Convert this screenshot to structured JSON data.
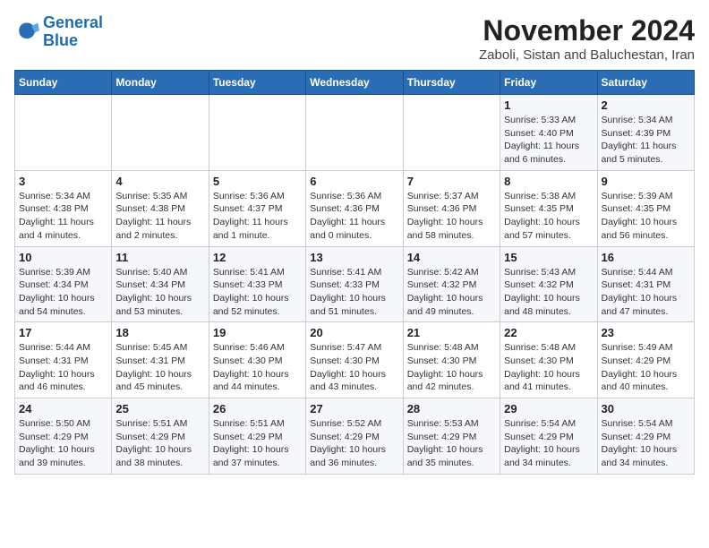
{
  "logo": {
    "line1": "General",
    "line2": "Blue"
  },
  "title": "November 2024",
  "location": "Zaboli, Sistan and Baluchestan, Iran",
  "days_of_week": [
    "Sunday",
    "Monday",
    "Tuesday",
    "Wednesday",
    "Thursday",
    "Friday",
    "Saturday"
  ],
  "weeks": [
    [
      {
        "day": "",
        "detail": ""
      },
      {
        "day": "",
        "detail": ""
      },
      {
        "day": "",
        "detail": ""
      },
      {
        "day": "",
        "detail": ""
      },
      {
        "day": "",
        "detail": ""
      },
      {
        "day": "1",
        "detail": "Sunrise: 5:33 AM\nSunset: 4:40 PM\nDaylight: 11 hours and 6 minutes."
      },
      {
        "day": "2",
        "detail": "Sunrise: 5:34 AM\nSunset: 4:39 PM\nDaylight: 11 hours and 5 minutes."
      }
    ],
    [
      {
        "day": "3",
        "detail": "Sunrise: 5:34 AM\nSunset: 4:38 PM\nDaylight: 11 hours and 4 minutes."
      },
      {
        "day": "4",
        "detail": "Sunrise: 5:35 AM\nSunset: 4:38 PM\nDaylight: 11 hours and 2 minutes."
      },
      {
        "day": "5",
        "detail": "Sunrise: 5:36 AM\nSunset: 4:37 PM\nDaylight: 11 hours and 1 minute."
      },
      {
        "day": "6",
        "detail": "Sunrise: 5:36 AM\nSunset: 4:36 PM\nDaylight: 11 hours and 0 minutes."
      },
      {
        "day": "7",
        "detail": "Sunrise: 5:37 AM\nSunset: 4:36 PM\nDaylight: 10 hours and 58 minutes."
      },
      {
        "day": "8",
        "detail": "Sunrise: 5:38 AM\nSunset: 4:35 PM\nDaylight: 10 hours and 57 minutes."
      },
      {
        "day": "9",
        "detail": "Sunrise: 5:39 AM\nSunset: 4:35 PM\nDaylight: 10 hours and 56 minutes."
      }
    ],
    [
      {
        "day": "10",
        "detail": "Sunrise: 5:39 AM\nSunset: 4:34 PM\nDaylight: 10 hours and 54 minutes."
      },
      {
        "day": "11",
        "detail": "Sunrise: 5:40 AM\nSunset: 4:34 PM\nDaylight: 10 hours and 53 minutes."
      },
      {
        "day": "12",
        "detail": "Sunrise: 5:41 AM\nSunset: 4:33 PM\nDaylight: 10 hours and 52 minutes."
      },
      {
        "day": "13",
        "detail": "Sunrise: 5:41 AM\nSunset: 4:33 PM\nDaylight: 10 hours and 51 minutes."
      },
      {
        "day": "14",
        "detail": "Sunrise: 5:42 AM\nSunset: 4:32 PM\nDaylight: 10 hours and 49 minutes."
      },
      {
        "day": "15",
        "detail": "Sunrise: 5:43 AM\nSunset: 4:32 PM\nDaylight: 10 hours and 48 minutes."
      },
      {
        "day": "16",
        "detail": "Sunrise: 5:44 AM\nSunset: 4:31 PM\nDaylight: 10 hours and 47 minutes."
      }
    ],
    [
      {
        "day": "17",
        "detail": "Sunrise: 5:44 AM\nSunset: 4:31 PM\nDaylight: 10 hours and 46 minutes."
      },
      {
        "day": "18",
        "detail": "Sunrise: 5:45 AM\nSunset: 4:31 PM\nDaylight: 10 hours and 45 minutes."
      },
      {
        "day": "19",
        "detail": "Sunrise: 5:46 AM\nSunset: 4:30 PM\nDaylight: 10 hours and 44 minutes."
      },
      {
        "day": "20",
        "detail": "Sunrise: 5:47 AM\nSunset: 4:30 PM\nDaylight: 10 hours and 43 minutes."
      },
      {
        "day": "21",
        "detail": "Sunrise: 5:48 AM\nSunset: 4:30 PM\nDaylight: 10 hours and 42 minutes."
      },
      {
        "day": "22",
        "detail": "Sunrise: 5:48 AM\nSunset: 4:30 PM\nDaylight: 10 hours and 41 minutes."
      },
      {
        "day": "23",
        "detail": "Sunrise: 5:49 AM\nSunset: 4:29 PM\nDaylight: 10 hours and 40 minutes."
      }
    ],
    [
      {
        "day": "24",
        "detail": "Sunrise: 5:50 AM\nSunset: 4:29 PM\nDaylight: 10 hours and 39 minutes."
      },
      {
        "day": "25",
        "detail": "Sunrise: 5:51 AM\nSunset: 4:29 PM\nDaylight: 10 hours and 38 minutes."
      },
      {
        "day": "26",
        "detail": "Sunrise: 5:51 AM\nSunset: 4:29 PM\nDaylight: 10 hours and 37 minutes."
      },
      {
        "day": "27",
        "detail": "Sunrise: 5:52 AM\nSunset: 4:29 PM\nDaylight: 10 hours and 36 minutes."
      },
      {
        "day": "28",
        "detail": "Sunrise: 5:53 AM\nSunset: 4:29 PM\nDaylight: 10 hours and 35 minutes."
      },
      {
        "day": "29",
        "detail": "Sunrise: 5:54 AM\nSunset: 4:29 PM\nDaylight: 10 hours and 34 minutes."
      },
      {
        "day": "30",
        "detail": "Sunrise: 5:54 AM\nSunset: 4:29 PM\nDaylight: 10 hours and 34 minutes."
      }
    ]
  ]
}
